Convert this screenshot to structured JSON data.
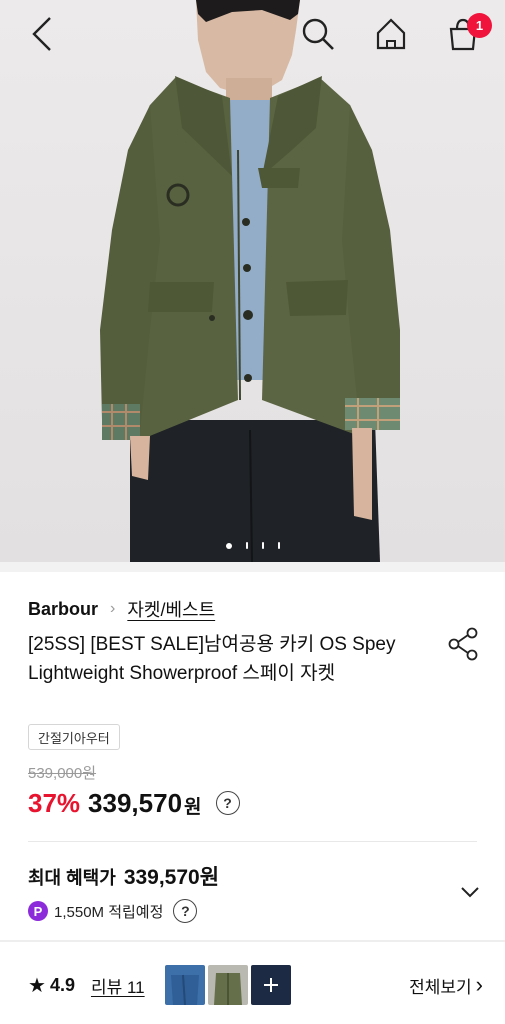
{
  "topbar": {
    "back_icon": "chevron-left-icon",
    "search_icon": "search-icon",
    "home_icon": "home-icon",
    "cart_icon": "shopping-bag-icon",
    "cart_count": "1"
  },
  "carousel": {
    "current_index": 1,
    "total": 4
  },
  "product": {
    "brand": "Barbour",
    "category": "자켓/베스트",
    "title": "[25SS] [BEST SALE]남여공용 카키 OS Spey Lightweight Showerproof 스페이 자켓",
    "tag": "간절기아우터",
    "original_price": "539,000원",
    "discount": "37%",
    "price": "339,570",
    "price_unit": "원",
    "price_info_icon": "?"
  },
  "benefit": {
    "label": "최대 혜택가",
    "amount": "339,570원",
    "points_badge": "P",
    "points_text": "1,550M 적립예정",
    "points_info_icon": "?"
  },
  "reviews": {
    "star": "★",
    "rating": "4.9",
    "link_label": "리뷰 11",
    "see_all_label": "전체보기",
    "see_all_chevron": "›"
  },
  "colors": {
    "accent_red": "#e8132e",
    "badge_red": "#f0143c",
    "points_purple": "#8c2bd9",
    "jacket_khaki": "#5a6340"
  }
}
